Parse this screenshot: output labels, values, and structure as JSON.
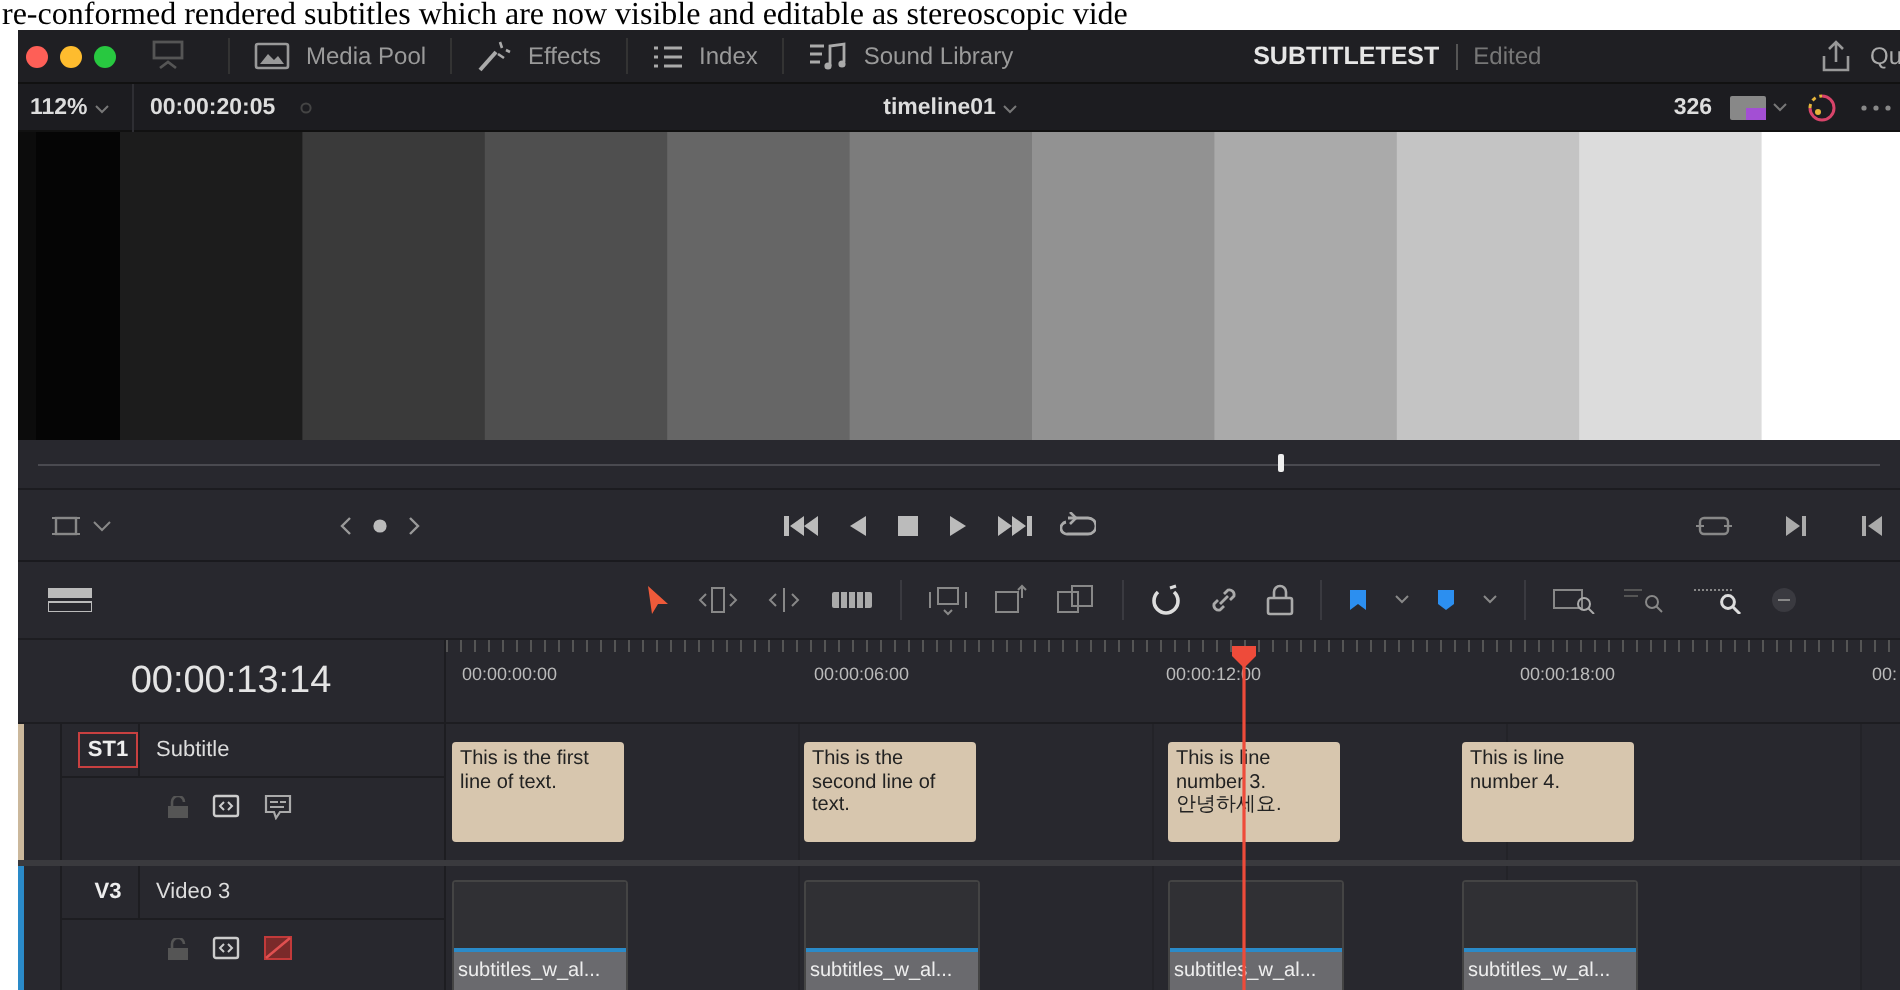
{
  "caption": "re-conformed rendered subtitles which are now visible and editable as stereoscopic vide",
  "window": {
    "tabs": [
      {
        "label": "Media Pool",
        "kind": "media"
      },
      {
        "label": "Effects",
        "kind": "effects"
      },
      {
        "label": "Index",
        "kind": "index"
      },
      {
        "label": "Sound Library",
        "kind": "sound"
      }
    ],
    "project": "SUBTITLETEST",
    "status": "Edited",
    "share_label": "Qu"
  },
  "viewer": {
    "zoom": "112%",
    "timecode": "00:00:20:05",
    "timeline": "timeline01",
    "frame_count": "326",
    "kind": "picture"
  },
  "tools": [
    {
      "kind": "select",
      "selected": true
    },
    {
      "kind": "trim",
      "selected": false
    },
    {
      "kind": "dynamic",
      "selected": false
    },
    {
      "kind": "blade",
      "selected": false
    }
  ],
  "timeline": {
    "timecode": "00:00:13:14",
    "ruler": [
      "00:00:00:00",
      "00:00:06:00",
      "00:00:12:00",
      "00:00:18:00",
      "00:"
    ],
    "tracks": [
      {
        "id": "ST1",
        "name": "Subtitle",
        "kind": "subtitle",
        "selected": true,
        "clips": [
          "This is the first line of text.",
          "This is the second line of text.",
          "This is line number 3. 안녕하세요.",
          "This is line number 4."
        ]
      },
      {
        "id": "V3",
        "name": "Video 3",
        "kind": "video",
        "selected": false,
        "clips": [
          "subtitles_w_al...",
          "subtitles_w_al...",
          "subtitles_w_al...",
          "subtitles_w_al..."
        ]
      }
    ]
  }
}
